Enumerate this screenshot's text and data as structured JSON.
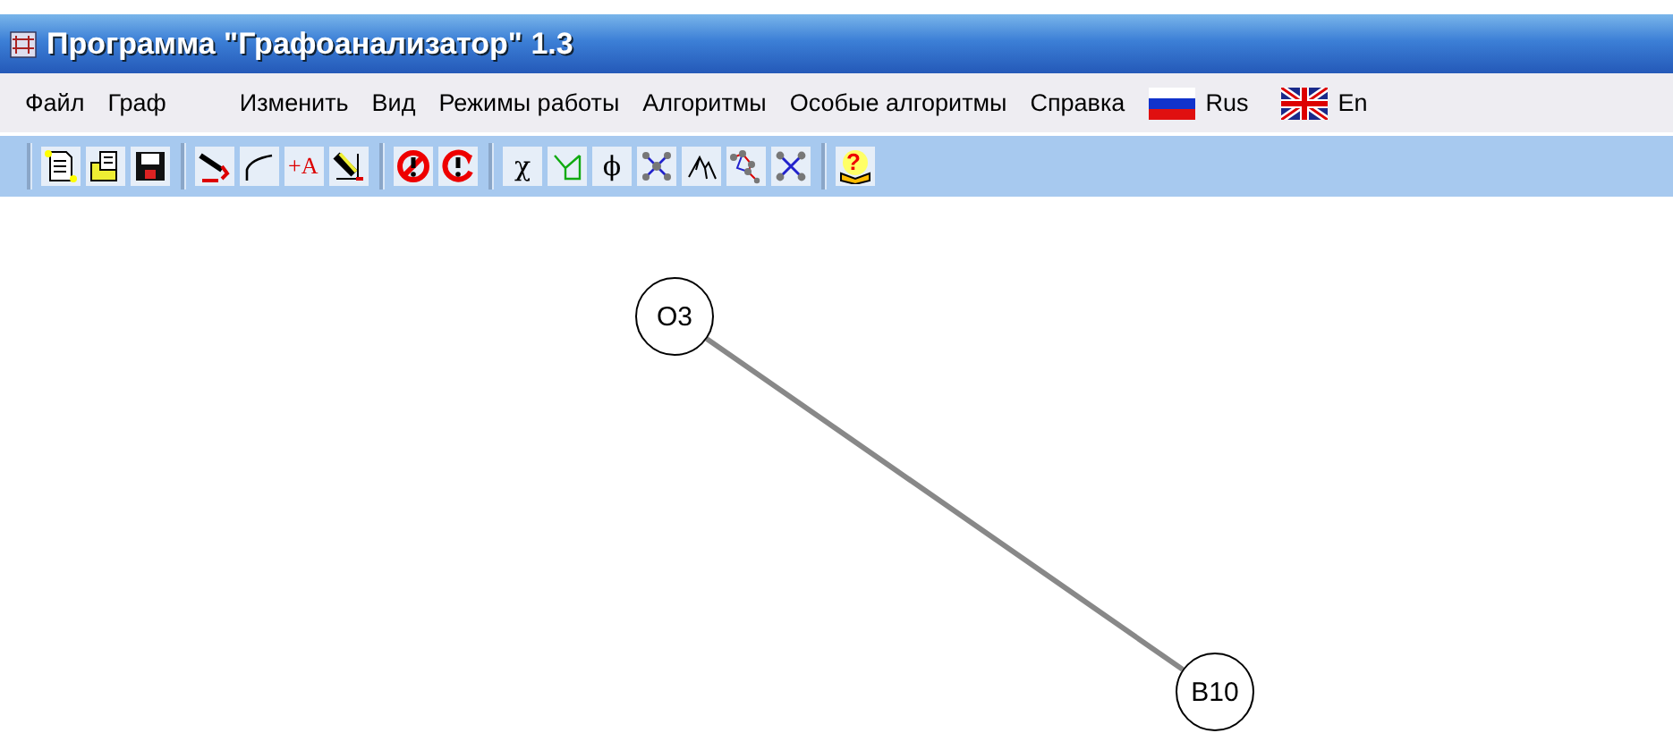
{
  "window": {
    "title": "Программа \"Графоанализатор\" 1.3"
  },
  "menu": [
    {
      "kind": "text",
      "label": "Файл"
    },
    {
      "kind": "text",
      "label": "Граф"
    },
    {
      "kind": "text",
      "label": "Изменить"
    },
    {
      "kind": "text",
      "label": "Вид"
    },
    {
      "kind": "text",
      "label": "Режимы работы"
    },
    {
      "kind": "text",
      "label": "Алгоритмы"
    },
    {
      "kind": "text",
      "label": "Особые алгоритмы"
    },
    {
      "kind": "text",
      "label": "Справка"
    },
    {
      "kind": "flag-ru",
      "label": "Rus"
    },
    {
      "kind": "flag-uk",
      "label": "En"
    }
  ],
  "toolbar": [
    [
      {
        "kind": "new"
      },
      {
        "kind": "open"
      },
      {
        "kind": "save"
      }
    ],
    [
      {
        "kind": "pen"
      },
      {
        "kind": "curve"
      },
      {
        "kind": "add-text",
        "glyph": "+A"
      },
      {
        "kind": "edit"
      }
    ],
    [
      {
        "kind": "stop"
      },
      {
        "kind": "restart"
      }
    ],
    [
      {
        "kind": "glyph",
        "glyph": "χ"
      },
      {
        "kind": "graph"
      },
      {
        "kind": "glyph",
        "glyph": "ϕ"
      },
      {
        "kind": "net"
      },
      {
        "kind": "tree"
      },
      {
        "kind": "path"
      },
      {
        "kind": "star"
      }
    ],
    [
      {
        "kind": "help",
        "glyph": "?"
      }
    ]
  ],
  "graph": {
    "nodes": [
      {
        "label": "O3"
      },
      {
        "label": "B10"
      }
    ]
  }
}
